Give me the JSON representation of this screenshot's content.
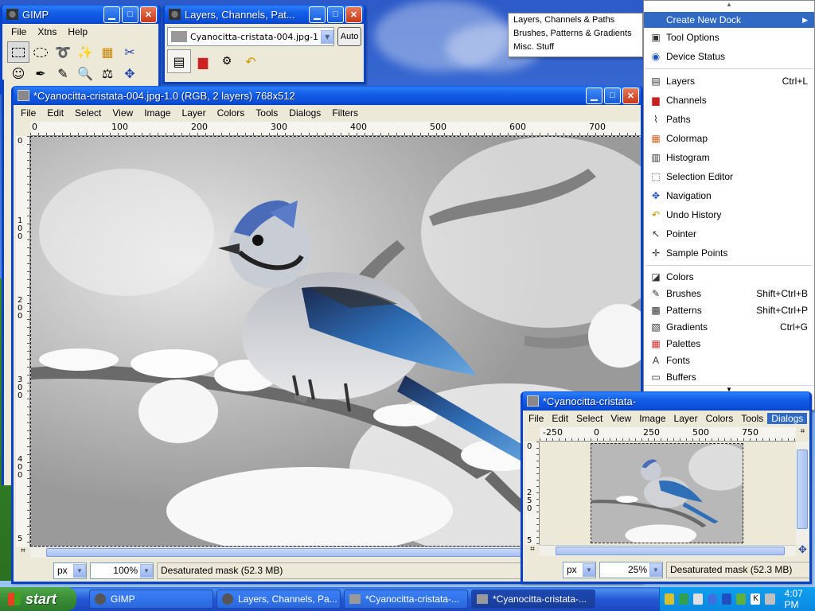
{
  "desktop": {
    "bg": "#3a6fd8"
  },
  "toolbox": {
    "title": "GIMP",
    "menu": [
      "File",
      "Xtns",
      "Help"
    ]
  },
  "layers_dock": {
    "title": "Layers, Channels, Pat...",
    "image_combo": "Cyanocitta-cristata-004.jpg-1",
    "auto_button": "Auto"
  },
  "main_image": {
    "title": "*Cyanocitta-cristata-004.jpg-1.0 (RGB, 2 layers) 768x512",
    "menu": [
      "File",
      "Edit",
      "Select",
      "View",
      "Image",
      "Layer",
      "Colors",
      "Tools",
      "Dialogs",
      "Filters"
    ],
    "hruler_ticks": [
      "0",
      "100",
      "200",
      "300",
      "400",
      "500",
      "600",
      "700"
    ],
    "vruler_ticks": [
      "0",
      "1\n0\n0",
      "2\n0\n0",
      "3\n0\n0",
      "4\n0\n0",
      "5"
    ],
    "unit": "px",
    "zoom": "100%",
    "status": "Desaturated mask (52.3 MB)"
  },
  "small_image": {
    "title": "*Cyanocitta-cristata-",
    "menu": [
      "File",
      "Edit",
      "Select",
      "View",
      "Image",
      "Layer",
      "Colors",
      "Tools",
      "Dialogs"
    ],
    "hruler_ticks": [
      "-250",
      "0",
      "250",
      "500",
      "750"
    ],
    "vruler_ticks": [
      "0",
      "2\n5\n0",
      "5"
    ],
    "unit": "px",
    "zoom": "25%",
    "status": "Desaturated mask (52.3 MB)"
  },
  "submenu": {
    "items": [
      "Layers, Channels & Paths",
      "Brushes, Patterns & Gradients",
      "Misc. Stuff"
    ]
  },
  "dialogs_menu": {
    "create_new_dock": "Create New Dock",
    "group1": [
      {
        "label": "Tool Options",
        "icon": "tool-options-icon",
        "shortcut": ""
      },
      {
        "label": "Device Status",
        "icon": "device-status-icon",
        "shortcut": ""
      }
    ],
    "group2": [
      {
        "label": "Layers",
        "icon": "layers-icon",
        "shortcut": "Ctrl+L"
      },
      {
        "label": "Channels",
        "icon": "channels-icon",
        "shortcut": ""
      },
      {
        "label": "Paths",
        "icon": "paths-icon",
        "shortcut": ""
      },
      {
        "label": "Colormap",
        "icon": "colormap-icon",
        "shortcut": ""
      },
      {
        "label": "Histogram",
        "icon": "histogram-icon",
        "shortcut": ""
      },
      {
        "label": "Selection Editor",
        "icon": "selection-editor-icon",
        "shortcut": ""
      },
      {
        "label": "Navigation",
        "icon": "navigation-icon",
        "shortcut": ""
      },
      {
        "label": "Undo History",
        "icon": "undo-history-icon",
        "shortcut": ""
      },
      {
        "label": "Pointer",
        "icon": "pointer-icon",
        "shortcut": ""
      },
      {
        "label": "Sample Points",
        "icon": "sample-points-icon",
        "shortcut": ""
      }
    ],
    "group3": [
      {
        "label": "Colors",
        "icon": "colors-icon",
        "shortcut": ""
      },
      {
        "label": "Brushes",
        "icon": "brushes-icon",
        "shortcut": "Shift+Ctrl+B"
      },
      {
        "label": "Patterns",
        "icon": "patterns-icon",
        "shortcut": "Shift+Ctrl+P"
      },
      {
        "label": "Gradients",
        "icon": "gradients-icon",
        "shortcut": "Ctrl+G"
      },
      {
        "label": "Palettes",
        "icon": "palettes-icon",
        "shortcut": ""
      },
      {
        "label": "Fonts",
        "icon": "fonts-icon",
        "shortcut": ""
      },
      {
        "label": "Buffers",
        "icon": "buffers-icon",
        "shortcut": ""
      }
    ]
  },
  "taskbar": {
    "start": "start",
    "tasks": [
      "GIMP",
      "Layers, Channels, Pa...",
      "*Cyanocitta-cristata-...",
      "*Cyanocitta-cristata-..."
    ],
    "clock": "4:07 PM"
  }
}
